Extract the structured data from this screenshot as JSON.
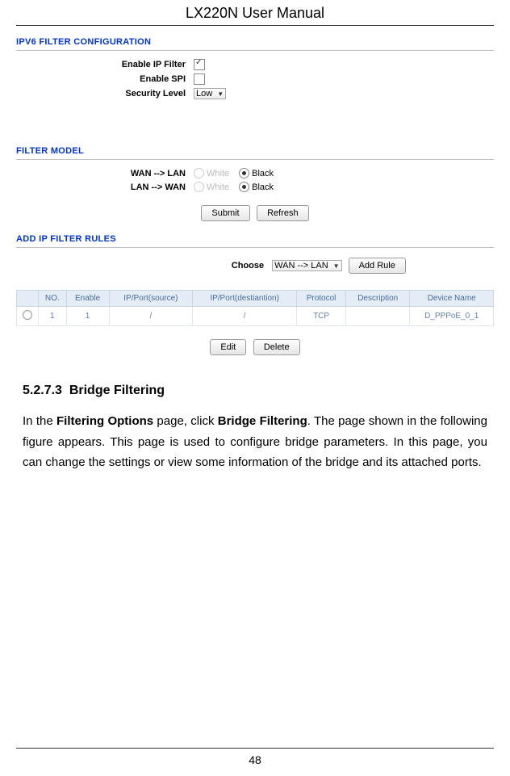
{
  "header": "LX220N User Manual",
  "ipv6_section_title": "IPV6 FILTER CONFIGURATION",
  "config": {
    "enable_ip_label": "Enable IP Filter",
    "enable_ip_checked": true,
    "enable_spi_label": "Enable SPI",
    "enable_spi_checked": false,
    "security_level_label": "Security Level",
    "security_level_value": "Low"
  },
  "filter_model_title": "FILTER MODEL",
  "filter_model": {
    "wan_lan_label": "WAN --> LAN",
    "lan_wan_label": "LAN --> WAN",
    "option_white": "White",
    "option_black": "Black",
    "wan_lan_selected": "Black",
    "lan_wan_selected": "Black"
  },
  "buttons": {
    "submit": "Submit",
    "refresh": "Refresh",
    "add_rule": "Add Rule",
    "edit": "Edit",
    "delete": "Delete"
  },
  "add_rules_title": "ADD IP FILTER RULES",
  "choose_label": "Choose",
  "choose_value": "WAN --> LAN",
  "table": {
    "headers": [
      "",
      "NO.",
      "Enable",
      "IP/Port(source)",
      "IP/Port(destiantion)",
      "Protocol",
      "Description",
      "Device Name"
    ],
    "row": [
      "",
      "1",
      "1",
      "/",
      "/",
      "TCP",
      "",
      "D_PPPoE_0_1"
    ]
  },
  "content": {
    "section_number": "5.2.7.3",
    "section_title": "Bridge Filtering",
    "paragraph_parts": {
      "p1": "In the ",
      "b1": "Filtering Options",
      "p2": " page, click ",
      "b2": "Bridge Filtering",
      "p3": ". The page shown in the following figure appears. This page is used to configure bridge parameters. In this page, you can change the settings or view some information of the bridge and its attached ports."
    }
  },
  "page_number": "48"
}
